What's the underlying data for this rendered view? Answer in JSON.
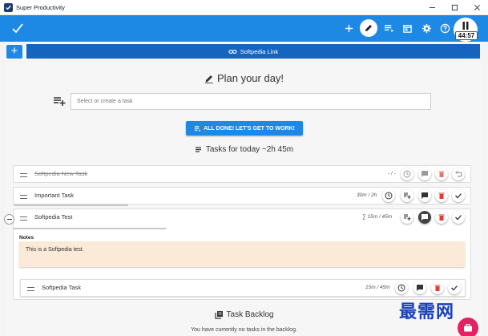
{
  "window": {
    "title": "Super Productivity"
  },
  "toolbar": {
    "timer": "44:57",
    "icons": [
      "add-icon",
      "focus-pencil-icon",
      "work-view-icon",
      "calendar-icon",
      "settings-icon",
      "help-icon",
      "pause-icon"
    ]
  },
  "project_bar": {
    "add_label": "+",
    "link_label": "Softpedia Link"
  },
  "plan": {
    "title": "Plan your day!",
    "input_placeholder": "Select or create a task",
    "done_button": "ALL DONE! LET'S GET TO WORK!",
    "today_title": "Tasks for today ~2h 45m"
  },
  "tasks": [
    {
      "title": "Softpedia New Task",
      "time": "- / -",
      "done": true
    },
    {
      "title": "Important Task",
      "time": "30m / 2h",
      "done": false
    },
    {
      "title": "Softpedia Test",
      "time": "∑ 15m / 45m",
      "done": false
    }
  ],
  "notes": {
    "label": "Notes",
    "text": "This is a Softpedia test."
  },
  "subtask": {
    "title": "Softpedia Task",
    "time": "15m / 45m"
  },
  "backlog": {
    "title": "Task Backlog",
    "empty_text": "You have currently no tasks in the backlog."
  },
  "watermark": "最需网",
  "colors": {
    "primary": "#1e88e5",
    "link_bar": "#1565c0",
    "accent": "#e91e63",
    "notes_bg": "#fbead8"
  }
}
